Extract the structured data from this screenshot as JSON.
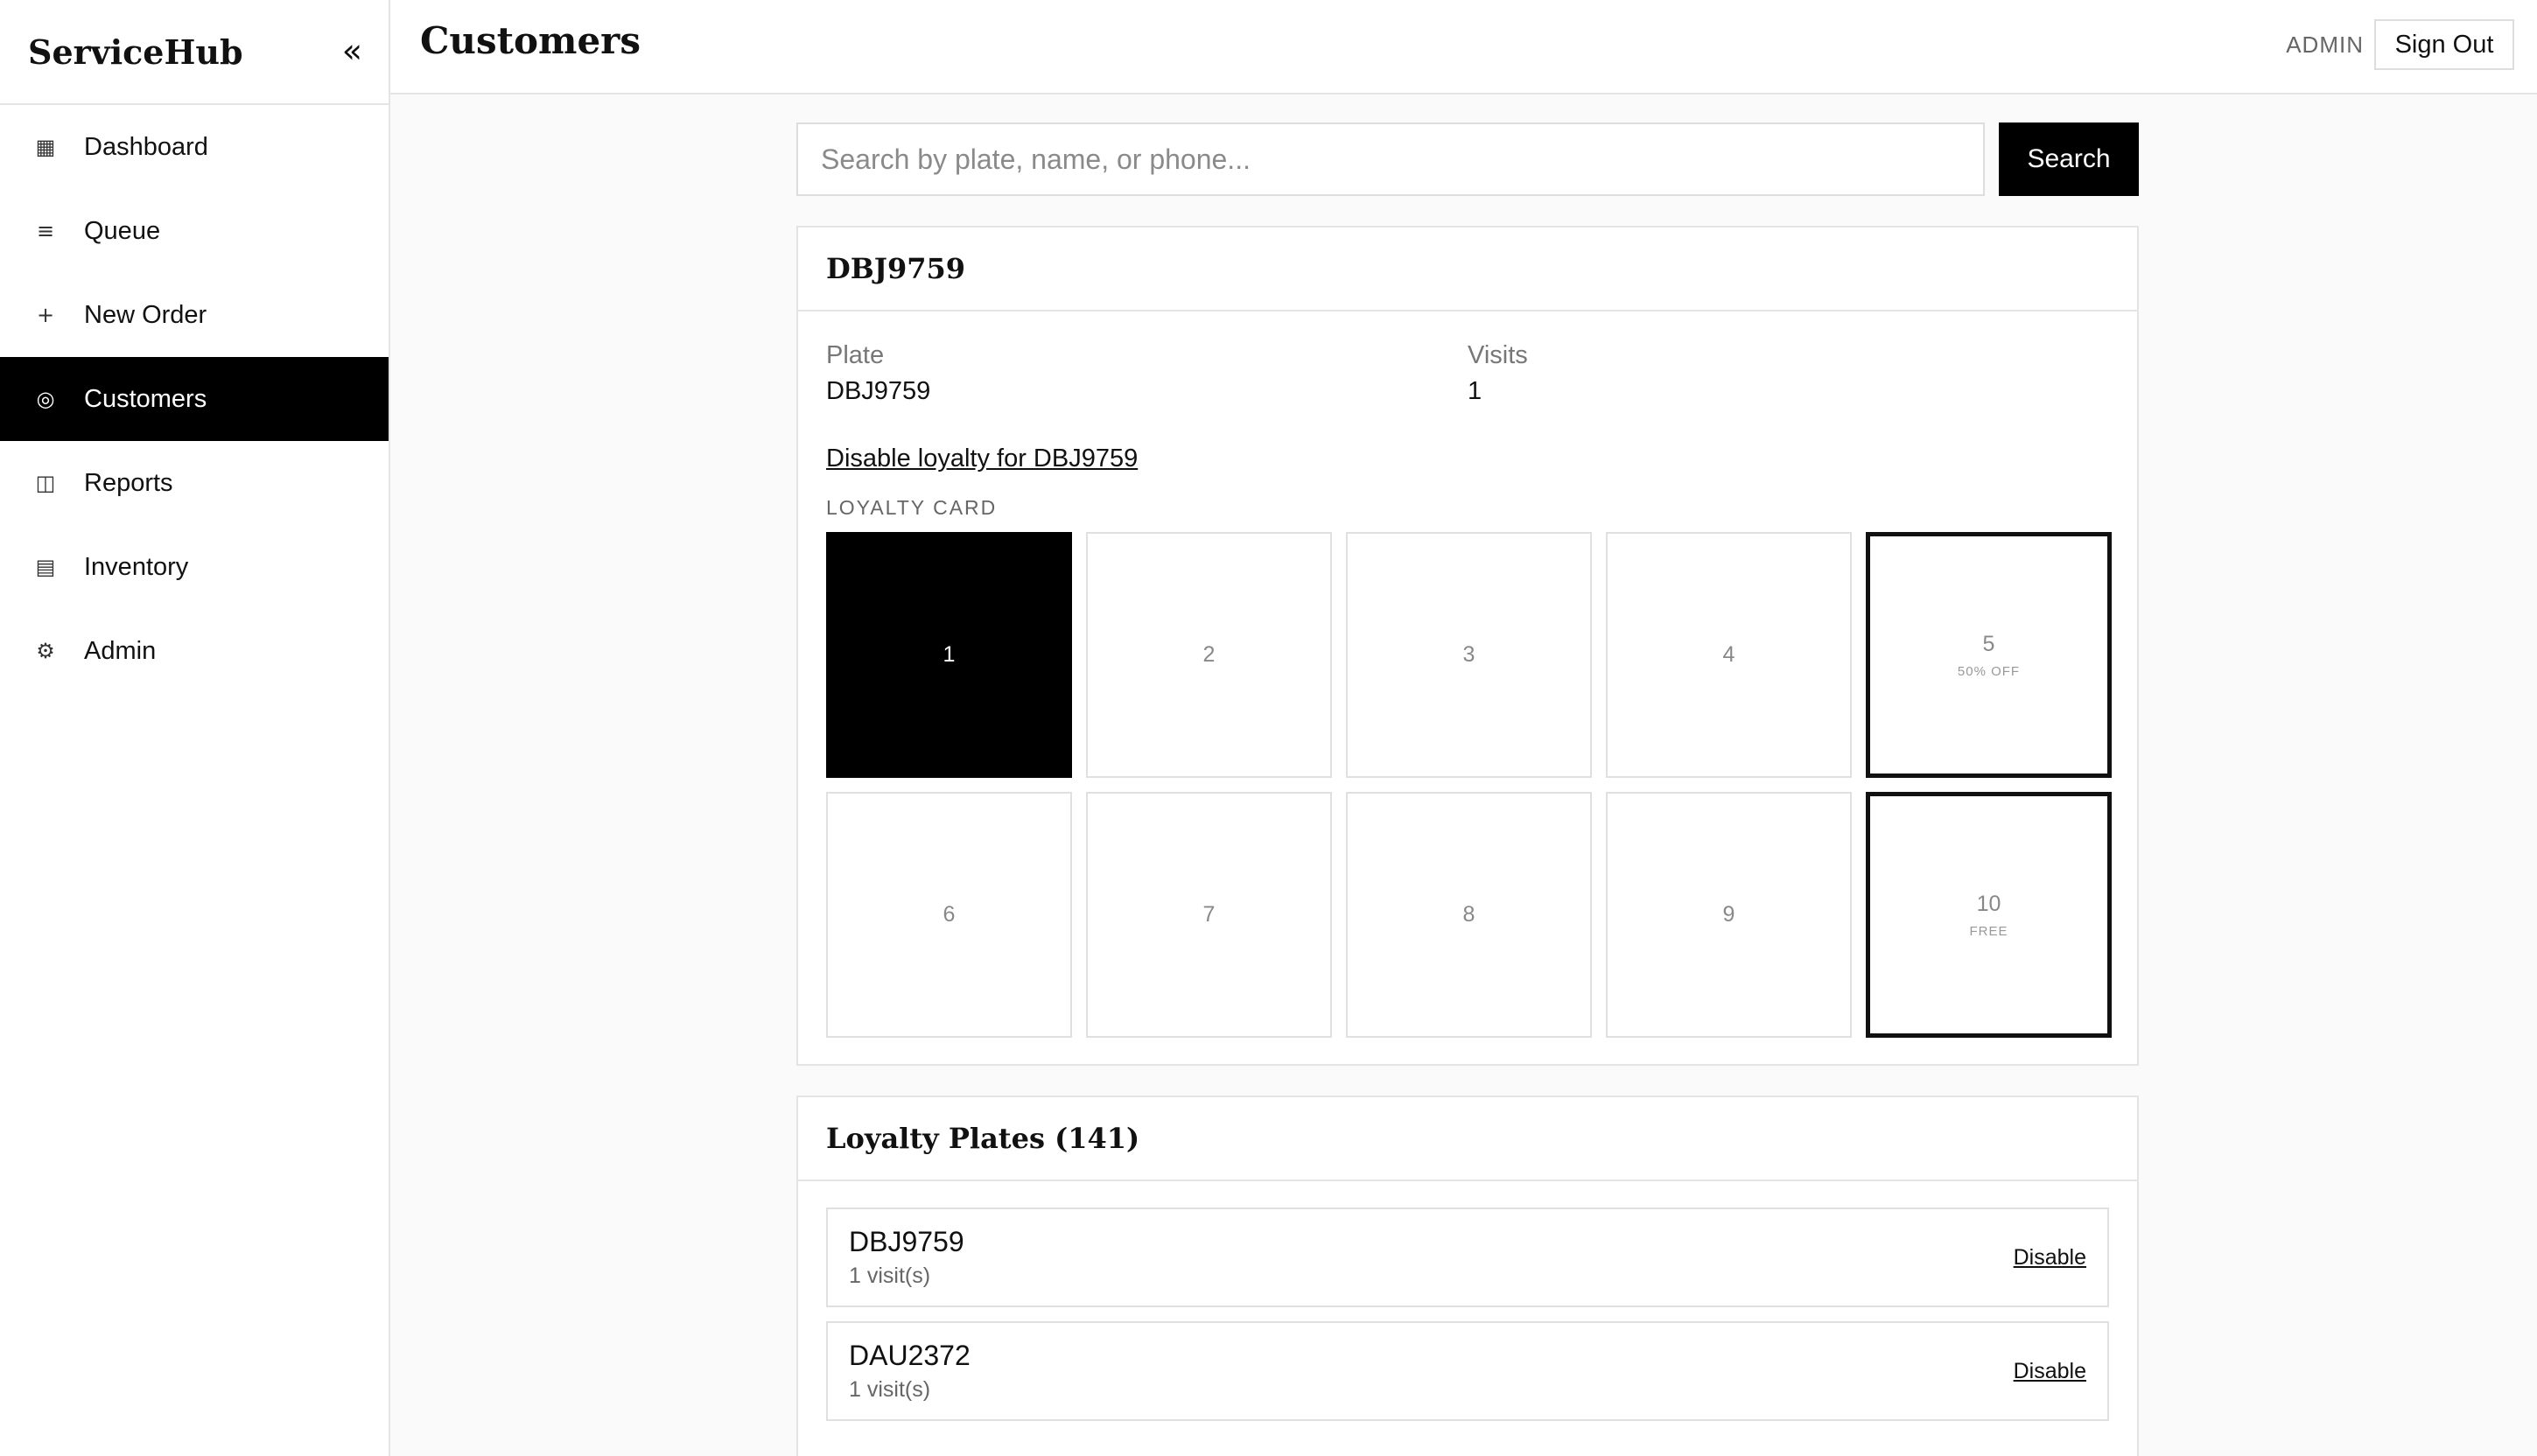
{
  "app": {
    "brand": "ServiceHub",
    "collapse_glyph": "«"
  },
  "sidebar": {
    "items": [
      {
        "label": "Dashboard",
        "icon": "dashboard-grid-icon",
        "glyph": "▦",
        "active": false
      },
      {
        "label": "Queue",
        "icon": "queue-list-icon",
        "glyph": "≡",
        "active": false
      },
      {
        "label": "New Order",
        "icon": "plus-icon",
        "glyph": "+",
        "active": false
      },
      {
        "label": "Customers",
        "icon": "customers-circle-icon",
        "glyph": "◎",
        "active": true
      },
      {
        "label": "Reports",
        "icon": "reports-columns-icon",
        "glyph": "◫",
        "active": false
      },
      {
        "label": "Inventory",
        "icon": "inventory-box-icon",
        "glyph": "▤",
        "active": false
      },
      {
        "label": "Admin",
        "icon": "gear-icon",
        "glyph": "⚙",
        "active": false
      }
    ]
  },
  "header": {
    "title": "Customers",
    "role": "ADMIN",
    "sign_out": "Sign Out"
  },
  "search": {
    "placeholder": "Search by plate, name, or phone...",
    "value": "",
    "button": "Search"
  },
  "customer": {
    "title": "DBJ9759",
    "plate_label": "Plate",
    "plate_value": "DBJ9759",
    "visits_label": "Visits",
    "visits_value": "1",
    "disable_link": "Disable loyalty for DBJ9759",
    "loyalty_label": "LOYALTY CARD",
    "stamps": [
      {
        "number": "1",
        "filled": true,
        "reward": ""
      },
      {
        "number": "2",
        "filled": false,
        "reward": ""
      },
      {
        "number": "3",
        "filled": false,
        "reward": ""
      },
      {
        "number": "4",
        "filled": false,
        "reward": ""
      },
      {
        "number": "5",
        "filled": false,
        "reward": "50% OFF"
      },
      {
        "number": "6",
        "filled": false,
        "reward": ""
      },
      {
        "number": "7",
        "filled": false,
        "reward": ""
      },
      {
        "number": "8",
        "filled": false,
        "reward": ""
      },
      {
        "number": "9",
        "filled": false,
        "reward": ""
      },
      {
        "number": "10",
        "filled": false,
        "reward": "FREE"
      }
    ]
  },
  "plates": {
    "title": "Loyalty Plates (141)",
    "rows": [
      {
        "plate": "DBJ9759",
        "visits": "1 visit(s)",
        "action": "Disable"
      },
      {
        "plate": "DAU2372",
        "visits": "1 visit(s)",
        "action": "Disable"
      }
    ]
  },
  "colors": {
    "accent": "#000000",
    "border": "#e4e4e4",
    "muted": "#777777"
  }
}
